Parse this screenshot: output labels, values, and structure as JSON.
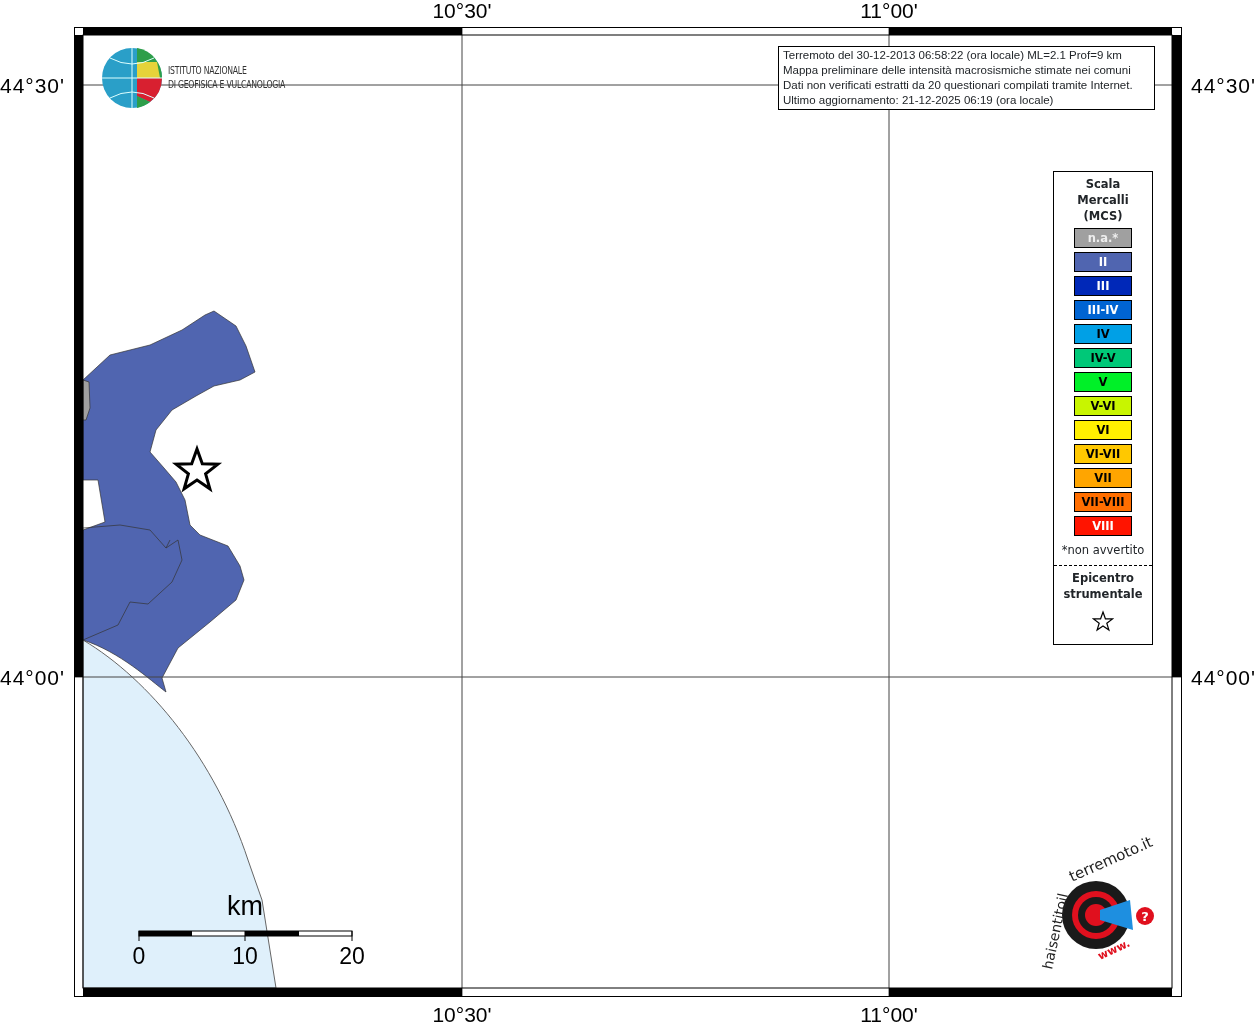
{
  "logo": {
    "lines": [
      "ISTITUTO NAZIONALE",
      "DI GEOFISICA E VULCANOLOGIA"
    ]
  },
  "info": [
    "Terremoto del 30-12-2013 06:58:22 (ora locale) ML=2.1 Prof=9 km",
    "Mappa preliminare delle intensità macrosismiche stimate nei comuni",
    "Dati non verificati estratti da 20 questionari compilati tramite Internet.",
    "Ultimo aggiornamento: 21-12-2025 06:19 (ora locale)"
  ],
  "axes": {
    "top": [
      "10°30'",
      "11°00'"
    ],
    "bottom": [
      "10°30'",
      "11°00'"
    ],
    "left": [
      "44°30'",
      "44°00'"
    ],
    "right": [
      "44°30'",
      "44°00'"
    ]
  },
  "legend": {
    "title": [
      "Scala",
      "Mercalli",
      "(MCS)"
    ],
    "items": [
      {
        "label": "n.a.*",
        "color": "#a0a0a0"
      },
      {
        "label": "II",
        "color": "#5065b0"
      },
      {
        "label": "III",
        "color": "#0028b8"
      },
      {
        "label": "III-IV",
        "color": "#0064d2"
      },
      {
        "label": "IV",
        "color": "#00a0e6"
      },
      {
        "label": "IV-V",
        "color": "#00c878"
      },
      {
        "label": "V",
        "color": "#00f028"
      },
      {
        "label": "V-VI",
        "color": "#c8f500"
      },
      {
        "label": "VI",
        "color": "#fff000"
      },
      {
        "label": "VI-VII",
        "color": "#ffc800"
      },
      {
        "label": "VII",
        "color": "#ffa500"
      },
      {
        "label": "VII-VIII",
        "color": "#ff6e00"
      },
      {
        "label": "VIII",
        "color": "#ff1400"
      }
    ],
    "note": "*non avvertito",
    "epicenter_title": [
      "Epicentro",
      "strumentale"
    ]
  },
  "scale": {
    "unit": "km",
    "ticks": [
      "0",
      "10",
      "20"
    ]
  },
  "badge": {
    "ring_text": [
      "haisentitoil",
      "terremoto.it"
    ],
    "www": "www.",
    "mark": "?"
  }
}
